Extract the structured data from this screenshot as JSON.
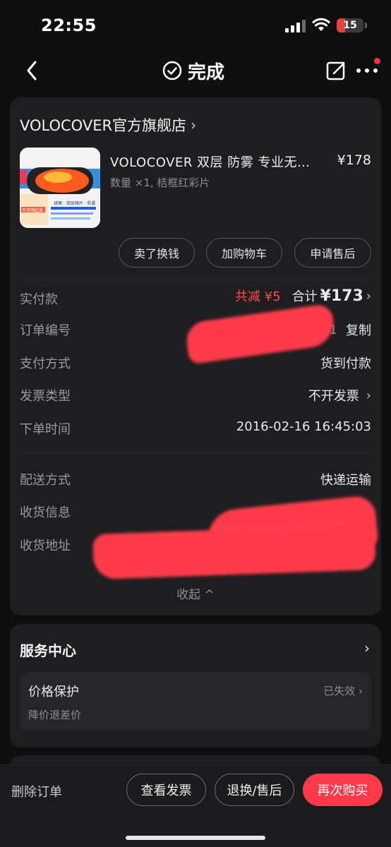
{
  "status_bar": {
    "time": "22:55",
    "battery": "15"
  },
  "nav": {
    "title": "完成"
  },
  "store": {
    "name": "VOLOCOVER官方旗舰店",
    "chevron": "›"
  },
  "product": {
    "title": "VOLOCOVER 双层 防雾 专业无…",
    "price": "¥178",
    "spec": "数量 ×1, 桔框红彩片",
    "image_texts": [
      "球面 · 双层镜片 · 防雾",
      "年货囤起来"
    ]
  },
  "actions": [
    "卖了换钱",
    "加购物车",
    "申请售后"
  ],
  "details": {
    "paid": {
      "label": "实付款",
      "discount": "共减 ¥5",
      "total_prefix": "合计 ",
      "total": "¥173"
    },
    "order_no": {
      "label": "订单编号",
      "value_suffix": "921",
      "copy": "复制"
    },
    "payment": {
      "label": "支付方式",
      "value": "货到付款"
    },
    "invoice": {
      "label": "发票类型",
      "value": "不开发票"
    },
    "order_time": {
      "label": "下单时间",
      "value": "2016-02-16 16:45:03"
    },
    "delivery": {
      "label": "配送方式",
      "value": "快递运输"
    },
    "receiver": {
      "label": "收货信息"
    },
    "address": {
      "label": "收货地址"
    },
    "collapse": "收起 ^"
  },
  "service": {
    "title": "服务中心",
    "item": {
      "name": "价格保护",
      "sub": "降价退差价",
      "status": "已失效"
    }
  },
  "bottom": {
    "delete": "删除订单",
    "view_invoice": "查看发票",
    "return": "退换/售后",
    "rebuy": "再次购买"
  },
  "colors": {
    "accent": "#ff3b4a",
    "background": "#0f0f10",
    "card": "#1e1e20"
  }
}
